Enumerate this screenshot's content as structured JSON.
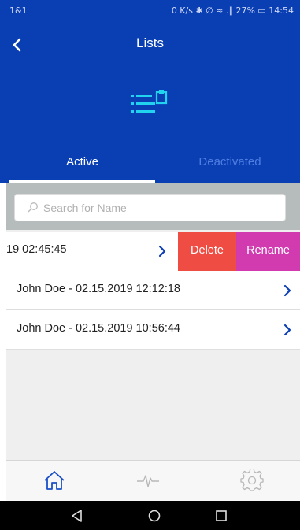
{
  "status": {
    "carrier": "1&1",
    "right": "0 K/s ✱ ∅ ≈ .∥ 27% ▭ 14:54"
  },
  "header": {
    "title": "Lists"
  },
  "tabs": [
    {
      "label": "Active",
      "selected": true
    },
    {
      "label": "Deactivated",
      "selected": false
    }
  ],
  "search": {
    "placeholder": "Search for Name",
    "value": ""
  },
  "list": {
    "swiped_item": {
      "label": "19 02:45:45",
      "delete_label": "Delete",
      "rename_label": "Rename"
    },
    "items": [
      {
        "label": "John Doe - 02.15.2019 12:12:18"
      },
      {
        "label": "John Doe - 02.15.2019 10:56:44"
      }
    ]
  },
  "bottom_nav": {
    "items": [
      "home-icon",
      "activity-icon",
      "settings-icon"
    ],
    "active": "home-icon"
  },
  "system_nav": [
    "back-triangle-icon",
    "home-circle-icon",
    "recents-square-icon"
  ],
  "colors": {
    "header_blue": "#0a3fb4",
    "accent_cyan": "#22d3f0",
    "delete_red": "#ef4d43",
    "rename_magenta": "#d23ab0"
  }
}
